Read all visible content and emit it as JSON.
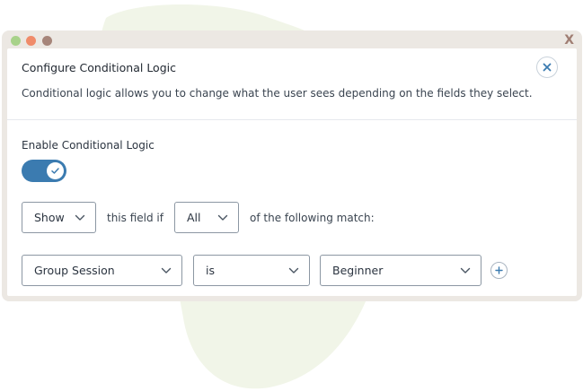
{
  "window": {
    "close_label": "X"
  },
  "modal": {
    "title": "Configure Conditional Logic",
    "description": "Conditional logic allows you to change what the user sees depending on the fields they select.",
    "close_icon": "close-icon"
  },
  "logic": {
    "enable_label": "Enable Conditional Logic",
    "enabled": true,
    "action_select": "Show",
    "text_this_field_if": "this field if",
    "match_select": "All",
    "text_following_match": "of the following match:"
  },
  "rule": {
    "field_select": "Group Session",
    "operator_select": "is",
    "value_select": "Beginner",
    "add_icon": "plus-circle-icon"
  },
  "colors": {
    "accent": "#3b7bb0",
    "window_frame": "#ece8e3",
    "background_blob": "#f1f5e8"
  }
}
